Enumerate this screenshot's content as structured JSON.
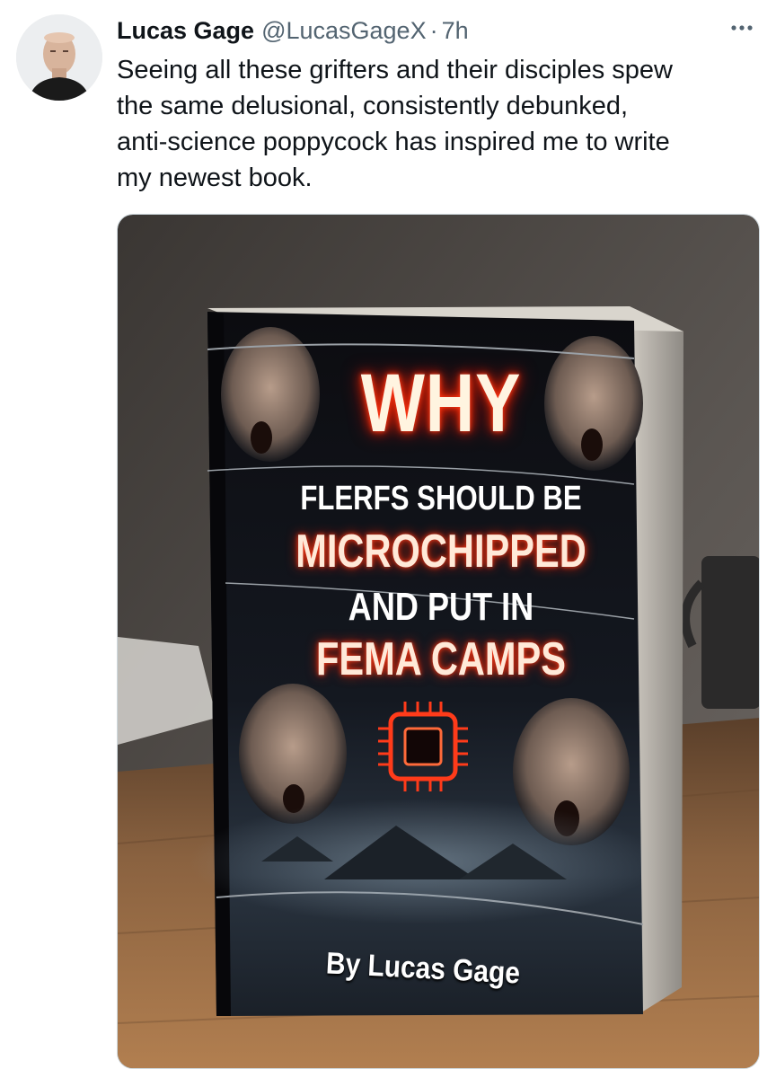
{
  "tweet": {
    "author_name": "Lucas Gage",
    "author_handle": "@LucasGageX",
    "separator": "·",
    "time": "7h",
    "text": "Seeing all these grifters and their disciples spew\nthe same delusional, consistently debunked,\nanti-science poppycock has inspired me to write\nmy newest book."
  },
  "book_cover": {
    "line1": "WHY",
    "line2": "FLERFS SHOULD BE",
    "line3": "MICROCHIPPED",
    "line4": "AND PUT IN",
    "line5": "FEMA CAMPS",
    "author": "By Lucas Gage"
  },
  "colors": {
    "text_primary": "#0f1419",
    "text_secondary": "#536471",
    "glow_red": "#ff2a00"
  },
  "icons": {
    "more": "more-dots-icon",
    "chip": "microchip-icon"
  }
}
